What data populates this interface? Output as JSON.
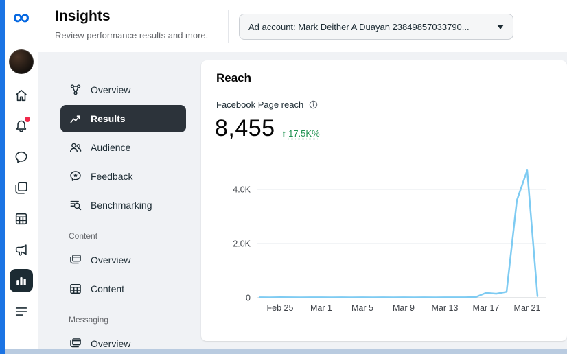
{
  "colors": {
    "brand_blue": "#0668E1",
    "window_accent": "#1b74e4",
    "selected_dark": "#2c333a",
    "positive_green": "#1d9150",
    "chart_line": "#7ecbf2"
  },
  "header": {
    "title": "Insights",
    "subtitle": "Review performance results and more.",
    "ad_account": "Ad account: Mark Deither A Duayan 23849857033790..."
  },
  "rail": {
    "icons": [
      "meta-logo",
      "profile-avatar",
      "home",
      "notifications",
      "chat",
      "content",
      "planner",
      "ads",
      "insights",
      "all-tools"
    ],
    "selected": "insights",
    "notification_badge": true
  },
  "sidebar": {
    "items": [
      {
        "label": "Overview"
      },
      {
        "label": "Results",
        "selected": true
      },
      {
        "label": "Audience"
      },
      {
        "label": "Feedback"
      },
      {
        "label": "Benchmarking"
      }
    ],
    "content_section": {
      "label": "Content",
      "items": [
        {
          "label": "Overview"
        },
        {
          "label": "Content"
        }
      ]
    },
    "messaging_section": {
      "label": "Messaging",
      "items": [
        {
          "label": "Overview"
        }
      ]
    }
  },
  "card": {
    "title": "Reach",
    "metric_label": "Facebook Page reach",
    "value": "8,455",
    "delta_arrow": "↑",
    "delta": "17.5K%"
  },
  "chart_data": {
    "type": "line",
    "title": "Facebook Page reach",
    "xlabel": "",
    "ylabel": "",
    "x": [
      "Feb 23",
      "Feb 24",
      "Feb 25",
      "Feb 26",
      "Feb 27",
      "Feb 28",
      "Mar 1",
      "Mar 2",
      "Mar 3",
      "Mar 4",
      "Mar 5",
      "Mar 6",
      "Mar 7",
      "Mar 8",
      "Mar 9",
      "Mar 10",
      "Mar 11",
      "Mar 12",
      "Mar 13",
      "Mar 14",
      "Mar 15",
      "Mar 16",
      "Mar 17",
      "Mar 18",
      "Mar 19",
      "Mar 20",
      "Mar 21",
      "Mar 22"
    ],
    "values": [
      15,
      12,
      18,
      14,
      12,
      16,
      14,
      12,
      15,
      13,
      14,
      12,
      14,
      13,
      15,
      12,
      14,
      13,
      16,
      14,
      15,
      25,
      180,
      150,
      220,
      3600,
      4700,
      60
    ],
    "yticks": [
      {
        "label": "0",
        "value": 0
      },
      {
        "label": "2.0K",
        "value": 2000
      },
      {
        "label": "4.0K",
        "value": 4000
      }
    ],
    "xticks": [
      {
        "label": "Feb 25",
        "index": 2
      },
      {
        "label": "Mar 1",
        "index": 6
      },
      {
        "label": "Mar 5",
        "index": 10
      },
      {
        "label": "Mar 9",
        "index": 14
      },
      {
        "label": "Mar 13",
        "index": 18
      },
      {
        "label": "Mar 17",
        "index": 22
      },
      {
        "label": "Mar 21",
        "index": 26
      }
    ],
    "ylim": [
      0,
      4700
    ],
    "grid": true,
    "legend": false,
    "line_color": "#7ecbf2"
  }
}
